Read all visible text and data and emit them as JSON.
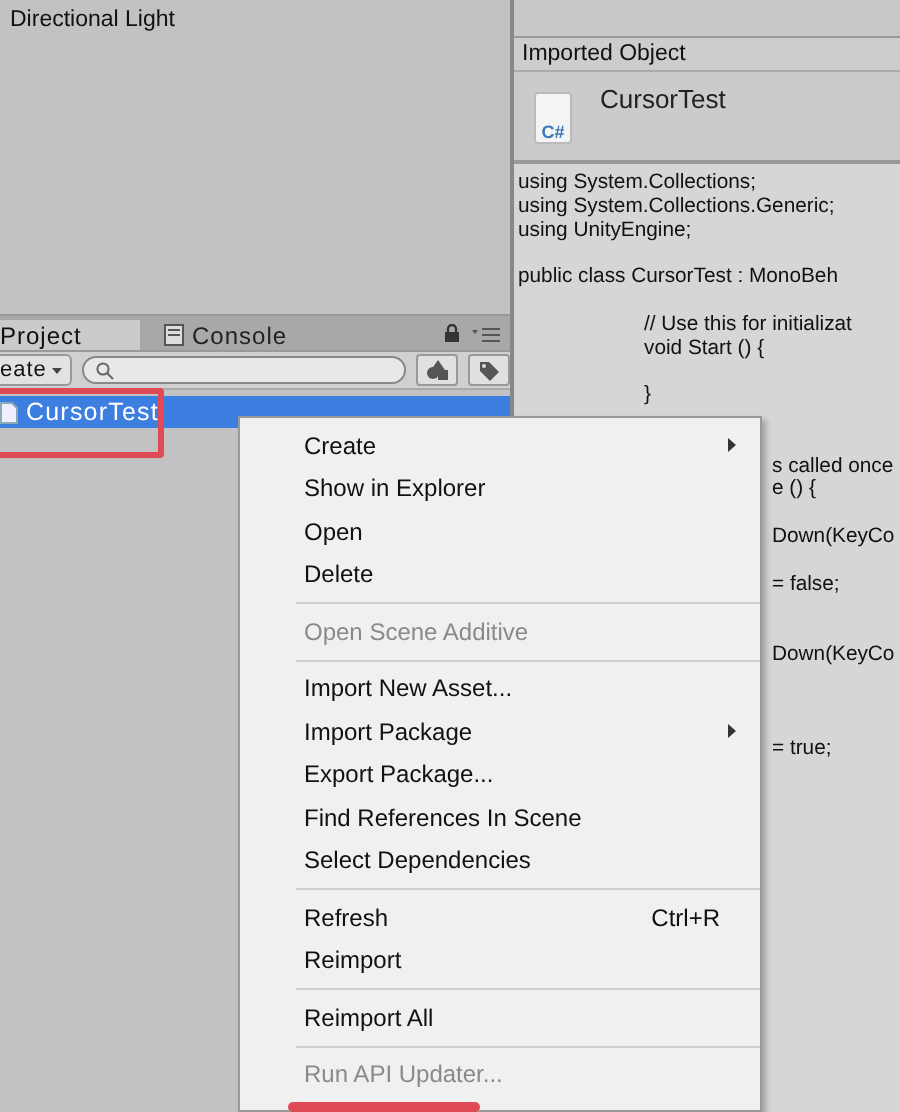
{
  "hierarchy": {
    "items": [
      {
        "label": "Directional Light"
      }
    ]
  },
  "inspector": {
    "header": "Imported Object",
    "asset_name": "CursorTest",
    "icon_text": "C#",
    "code_lines": [
      {
        "kind": "plain",
        "text": "using System.Collections;"
      },
      {
        "kind": "plain",
        "text": "using System.Collections.Generic;"
      },
      {
        "kind": "plain",
        "text": "using UnityEngine;"
      },
      {
        "kind": "blank"
      },
      {
        "kind": "plain",
        "text": "public class CursorTest : MonoBeh"
      },
      {
        "kind": "blank"
      },
      {
        "kind": "indented",
        "text": "// Use this for initializat"
      },
      {
        "kind": "indented",
        "text": "void Start () {"
      },
      {
        "kind": "blank"
      },
      {
        "kind": "indented",
        "text": "}"
      },
      {
        "kind": "blank"
      },
      {
        "kind": "blank"
      },
      {
        "kind": "tail",
        "text": "s called once"
      },
      {
        "kind": "tail",
        "text": "e () {"
      },
      {
        "kind": "blank"
      },
      {
        "kind": "tail",
        "text": "Down(KeyCo"
      },
      {
        "kind": "blank"
      },
      {
        "kind": "tail",
        "text": "= false;"
      },
      {
        "kind": "blank"
      },
      {
        "kind": "blank"
      },
      {
        "kind": "tail",
        "text": "Down(KeyCo"
      },
      {
        "kind": "blank"
      },
      {
        "kind": "blank"
      },
      {
        "kind": "blank"
      },
      {
        "kind": "tail",
        "text": "= true;"
      }
    ]
  },
  "project": {
    "tabs": [
      {
        "label": "Project",
        "selected": true
      },
      {
        "label": "Console",
        "selected": false
      }
    ],
    "create_button": "eate",
    "assets": [
      {
        "label": "CursorTest",
        "selected": true
      }
    ]
  },
  "context_menu": {
    "items": [
      {
        "kind": "item",
        "label": "Create",
        "submenu": true,
        "disabled": false
      },
      {
        "kind": "item",
        "label": "Show in Explorer",
        "submenu": false,
        "disabled": false
      },
      {
        "kind": "item",
        "label": "Open",
        "submenu": false,
        "disabled": false
      },
      {
        "kind": "item",
        "label": "Delete",
        "submenu": false,
        "disabled": false
      },
      {
        "kind": "separator"
      },
      {
        "kind": "item",
        "label": "Open Scene Additive",
        "submenu": false,
        "disabled": true
      },
      {
        "kind": "separator"
      },
      {
        "kind": "item",
        "label": "Import New Asset...",
        "submenu": false,
        "disabled": false
      },
      {
        "kind": "item",
        "label": "Import Package",
        "submenu": true,
        "disabled": false
      },
      {
        "kind": "item",
        "label": "Export Package...",
        "submenu": false,
        "disabled": false
      },
      {
        "kind": "item",
        "label": "Find References In Scene",
        "submenu": false,
        "disabled": false
      },
      {
        "kind": "item",
        "label": "Select Dependencies",
        "submenu": false,
        "disabled": false
      },
      {
        "kind": "separator"
      },
      {
        "kind": "item",
        "label": "Refresh",
        "submenu": false,
        "disabled": false,
        "shortcut": "Ctrl+R"
      },
      {
        "kind": "item",
        "label": "Reimport",
        "submenu": false,
        "disabled": false
      },
      {
        "kind": "separator"
      },
      {
        "kind": "item",
        "label": "Reimport All",
        "submenu": false,
        "disabled": false
      },
      {
        "kind": "separator"
      },
      {
        "kind": "item",
        "label": "Run API Updater...",
        "submenu": false,
        "disabled": true
      }
    ]
  },
  "annotations": {
    "asset_outline": true,
    "menu_bottom_bar": true
  }
}
